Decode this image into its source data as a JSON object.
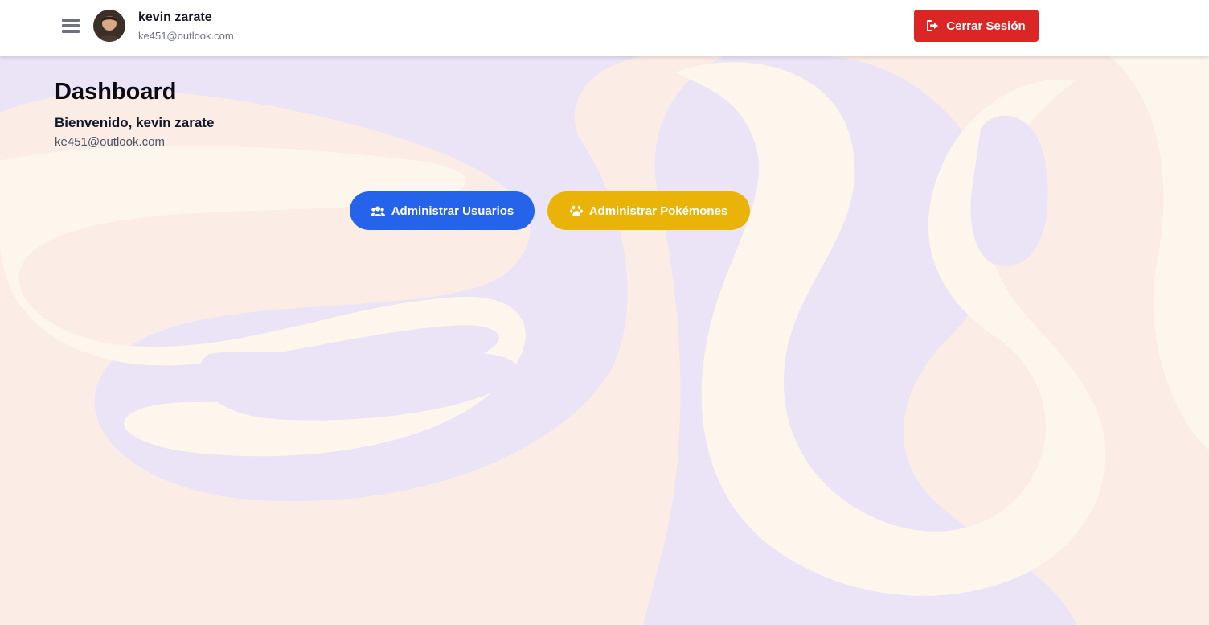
{
  "header": {
    "user_name": "kevin zarate",
    "user_email": "ke451@outlook.com",
    "logout_label": "Cerrar Sesión",
    "menu_icon": "hamburger-icon",
    "logout_icon": "sign-out-icon"
  },
  "main": {
    "title": "Dashboard",
    "welcome": "Bienvenido, kevin zarate",
    "email": "ke451@outlook.com"
  },
  "actions": {
    "users_label": "Administrar Usuarios",
    "users_icon": "users-icon",
    "pokemon_label": "Administrar Pokémones",
    "pokemon_icon": "paw-icon"
  },
  "colors": {
    "logout": "#dc2626",
    "users_button": "#2563eb",
    "pokemon_button": "#eab308",
    "background_lavender": "#ebe4f7",
    "background_cream": "#fdf6ec",
    "background_peach": "#fbece6"
  }
}
